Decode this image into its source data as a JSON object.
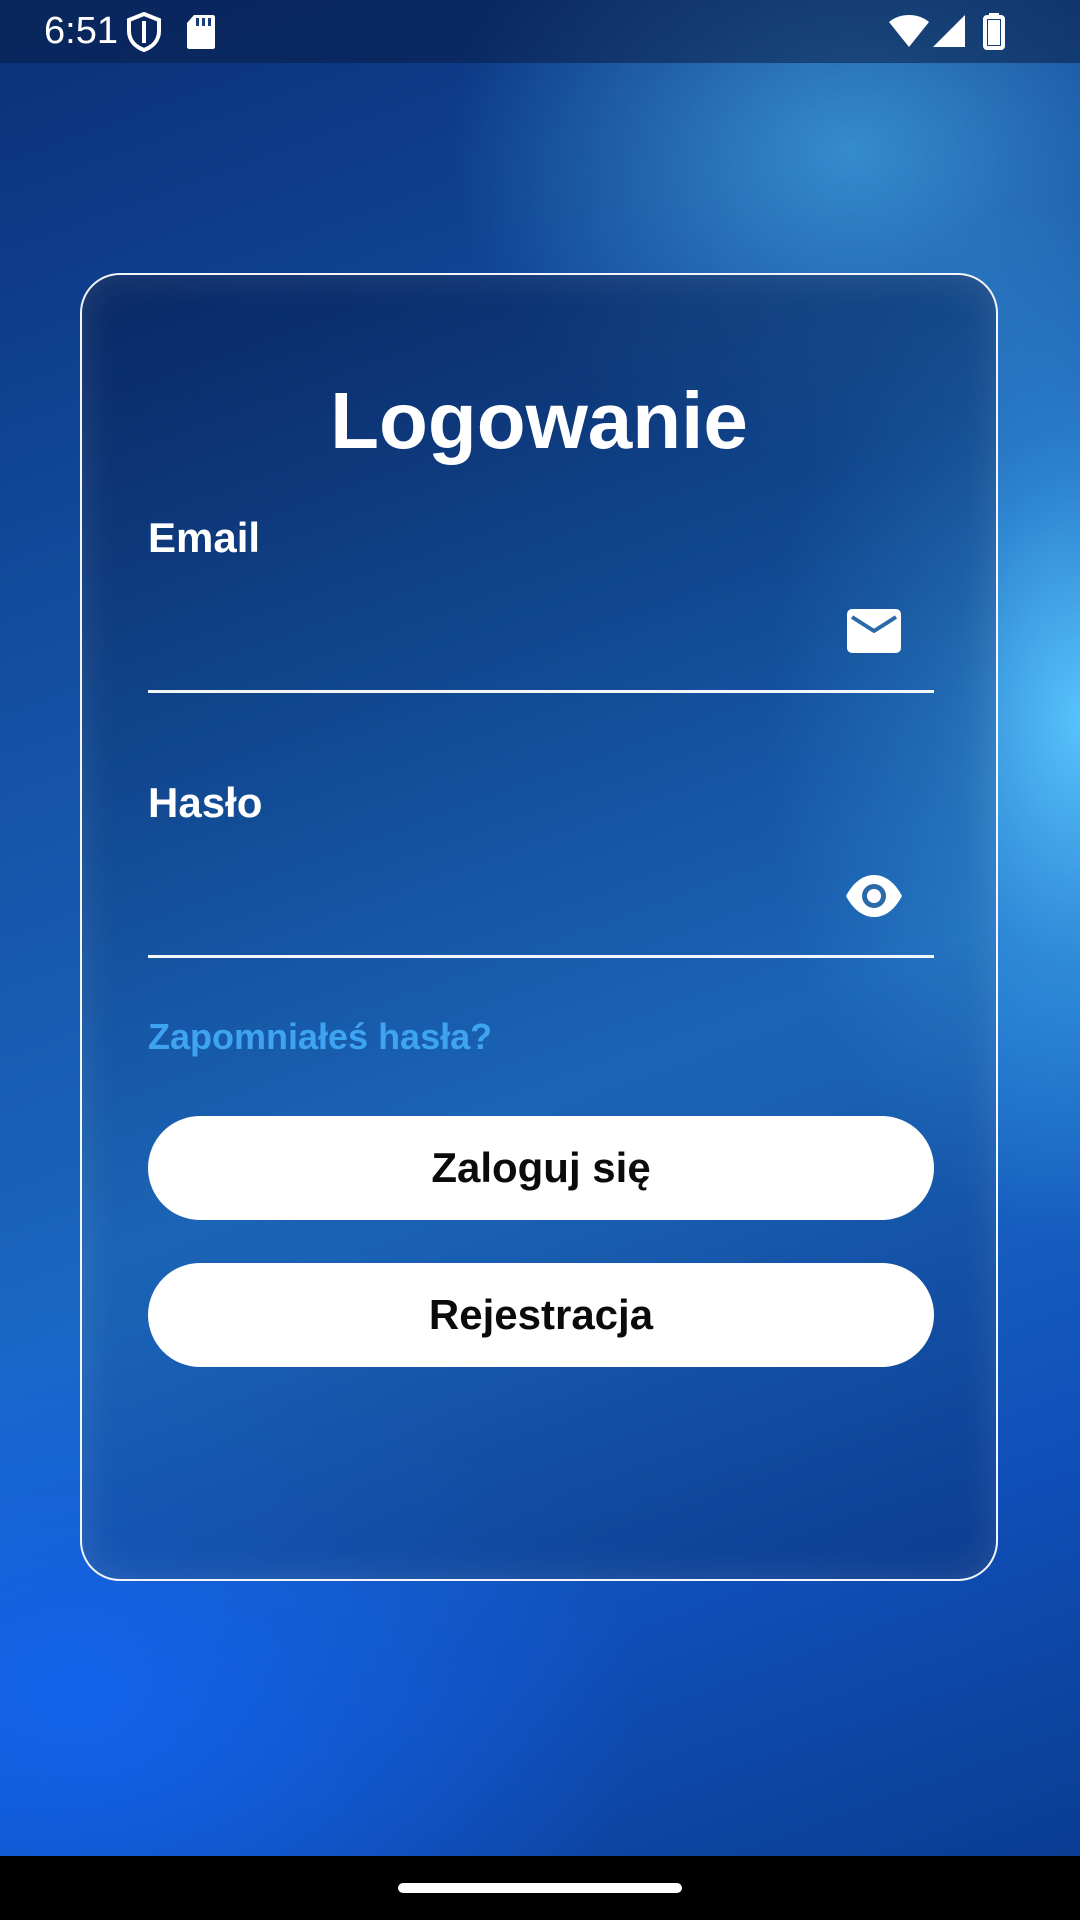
{
  "status_bar": {
    "time": "6:51",
    "icons": [
      "shield-icon",
      "sd-card-icon",
      "wifi-icon",
      "signal-icon",
      "battery-icon"
    ]
  },
  "login": {
    "title": "Logowanie",
    "email_label": "Email",
    "email_value": "",
    "email_icon": "mail-icon",
    "password_label": "Hasło",
    "password_value": "",
    "password_icon": "eye-icon",
    "forgot_password": "Zapomniałeś hasła?",
    "login_button": "Zaloguj się",
    "register_button": "Rejestracja"
  },
  "colors": {
    "link": "#3ea4f2",
    "button_bg": "#ffffff",
    "button_text": "#0b0b0b",
    "background_dark": "#0a2f78",
    "background_light": "#5ac8ff"
  }
}
